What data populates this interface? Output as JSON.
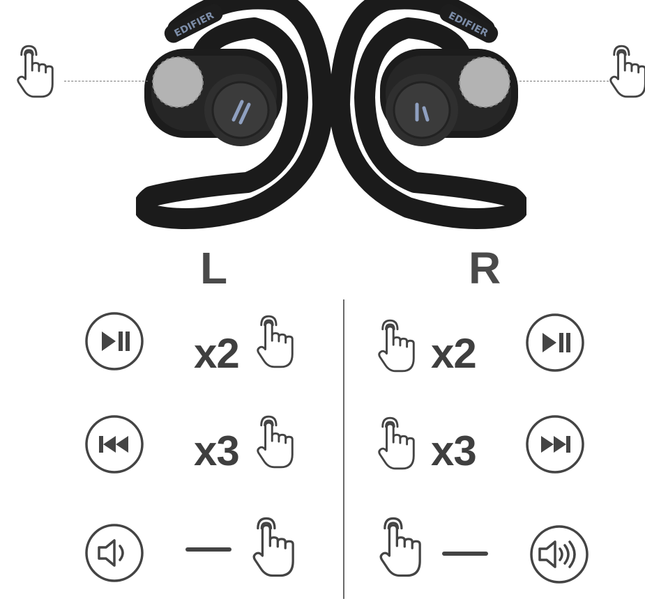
{
  "brand": {
    "left_band_text": "EDIFIER",
    "right_band_text": "EDIFIER"
  },
  "sides": {
    "left_label": "L",
    "right_label": "R"
  },
  "gestures": {
    "left": [
      {
        "action": "play-pause-icon",
        "taps": "x2"
      },
      {
        "action": "previous-track-icon",
        "taps": "x3"
      },
      {
        "action": "volume-down-icon",
        "taps": ""
      }
    ],
    "right": [
      {
        "action": "play-pause-icon",
        "taps": "x2"
      },
      {
        "action": "next-track-icon",
        "taps": "x3"
      },
      {
        "action": "volume-up-icon",
        "taps": ""
      }
    ]
  },
  "colors": {
    "earbud": "#1c1c1c",
    "touch_zone": "#b3b3b3",
    "icon_stroke": "#444444",
    "text": "#3f3f3f"
  }
}
